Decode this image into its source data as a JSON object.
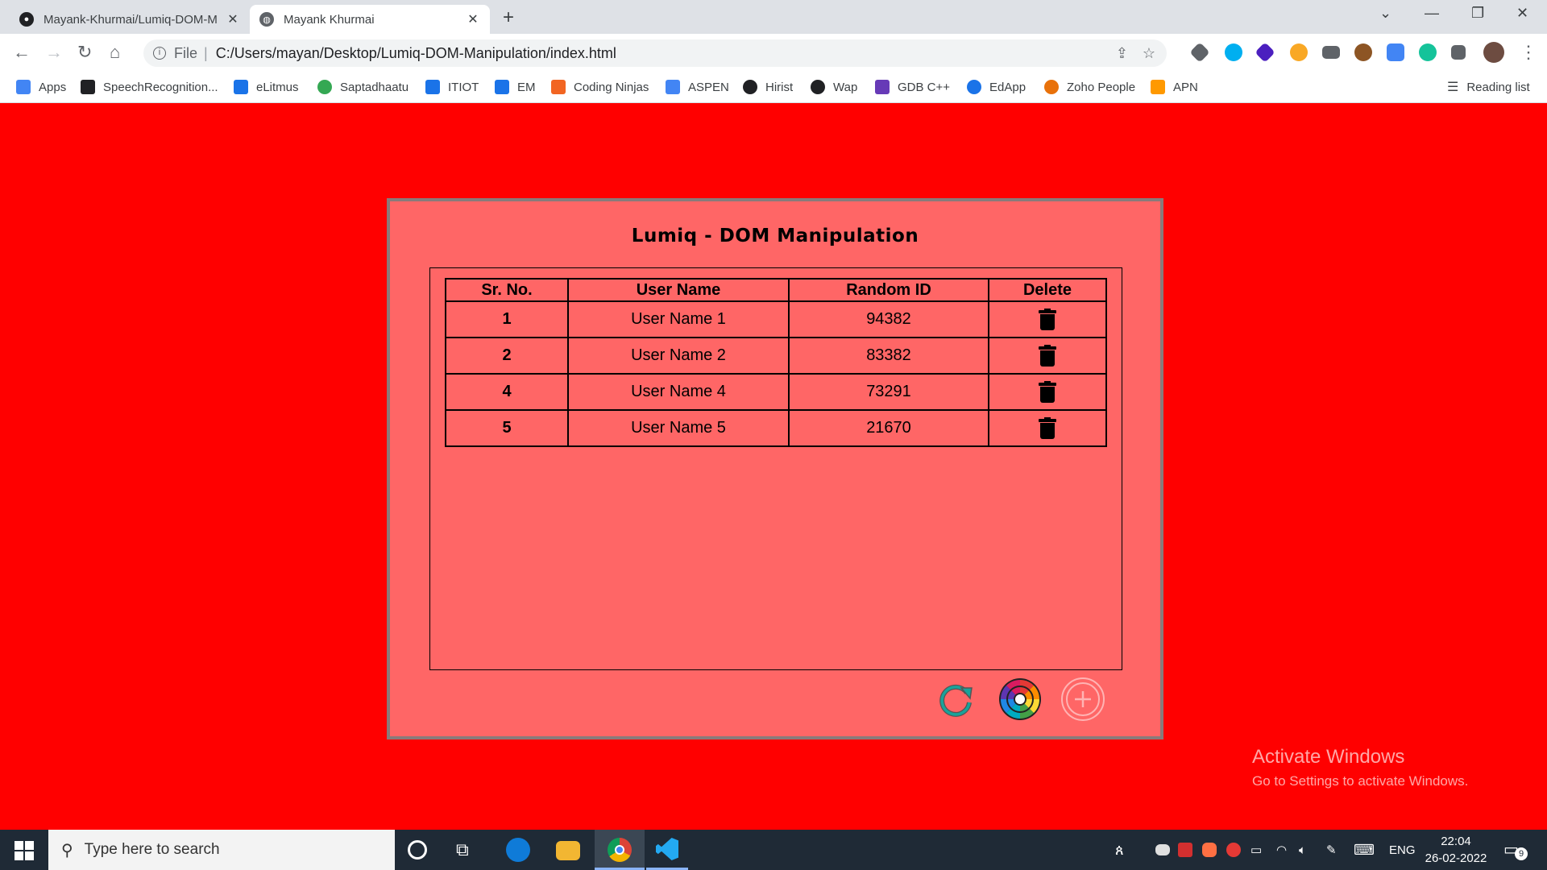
{
  "browser": {
    "tabs": [
      {
        "title": "Mayank-Khurmai/Lumiq-DOM-M",
        "active": false
      },
      {
        "title": "Mayank Khurmai",
        "active": true
      }
    ],
    "address": {
      "scheme": "File",
      "url": "C:/Users/mayan/Desktop/Lumiq-DOM-Manipulation/index.html"
    },
    "bookmarks": [
      {
        "label": "Apps",
        "color": "#4285f4"
      },
      {
        "label": "SpeechRecognition...",
        "color": "#202124"
      },
      {
        "label": "eLitmus",
        "color": "#1a73e8"
      },
      {
        "label": "Saptadhaatu",
        "color": "#34a853"
      },
      {
        "label": "ITIOT",
        "color": "#1a73e8"
      },
      {
        "label": "EM",
        "color": "#1a73e8"
      },
      {
        "label": "Coding Ninjas",
        "color": "#f26522"
      },
      {
        "label": "ASPEN",
        "color": "#4285f4"
      },
      {
        "label": "Hirist",
        "color": "#202124"
      },
      {
        "label": "Wap",
        "color": "#202124"
      },
      {
        "label": "GDB C++",
        "color": "#673ab7"
      },
      {
        "label": "EdApp",
        "color": "#1a73e8"
      },
      {
        "label": "Zoho People",
        "color": "#e8710a"
      },
      {
        "label": "APN",
        "color": "#ff9900"
      }
    ],
    "reading_list": "Reading list"
  },
  "page": {
    "title": "Lumiq - DOM Manipulation",
    "table": {
      "headers": [
        "Sr. No.",
        "User Name",
        "Random ID",
        "Delete"
      ],
      "rows": [
        {
          "sr": "1",
          "name": "User Name 1",
          "id": "94382"
        },
        {
          "sr": "2",
          "name": "User Name 2",
          "id": "83382"
        },
        {
          "sr": "4",
          "name": "User Name 4",
          "id": "73291"
        },
        {
          "sr": "5",
          "name": "User Name 5",
          "id": "21670"
        }
      ]
    },
    "icons": {
      "refresh": "refresh-icon",
      "palette": "color-wheel-icon",
      "add": "add-circle-icon",
      "delete": "trash-icon"
    },
    "colors": {
      "background": "#ff0000",
      "card": "#ff6666"
    }
  },
  "watermark": {
    "line1": "Activate Windows",
    "line2": "Go to Settings to activate Windows."
  },
  "taskbar": {
    "search_placeholder": "Type here to search",
    "language": "ENG",
    "time": "22:04",
    "date": "26-02-2022",
    "notifications": "9"
  }
}
